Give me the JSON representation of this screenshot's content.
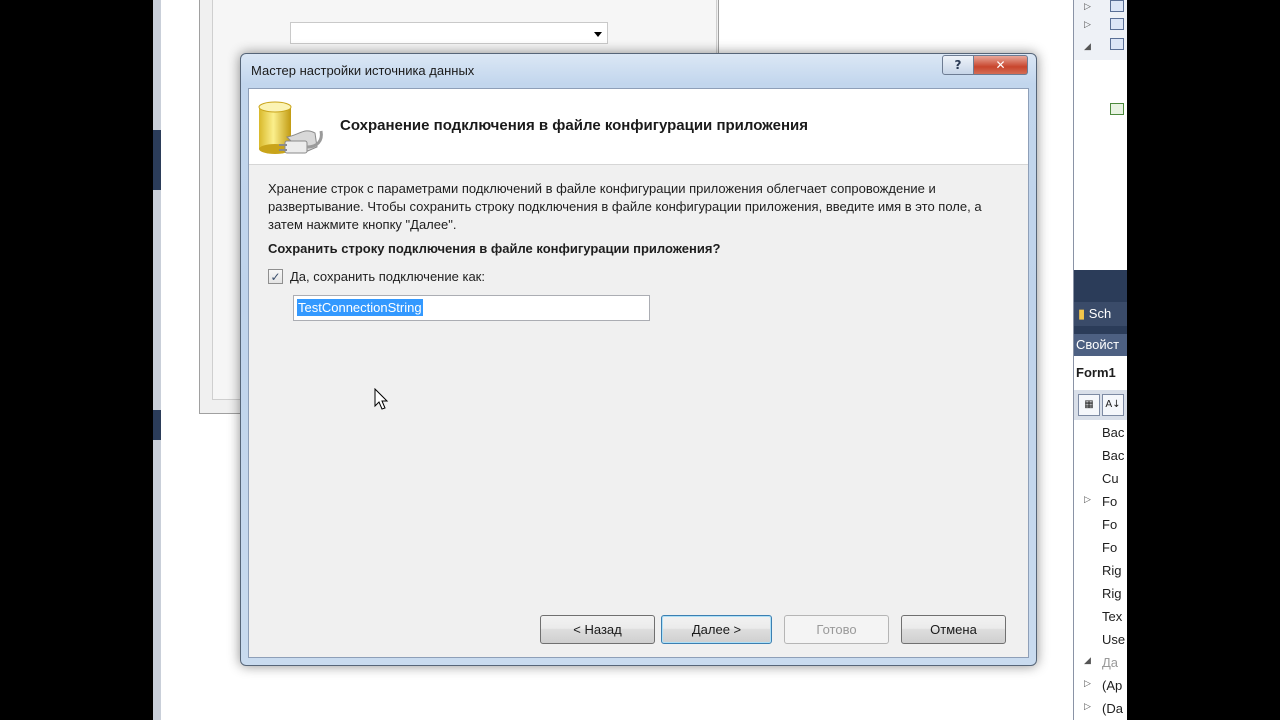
{
  "wizard": {
    "title": "Мастер настройки источника данных",
    "header_title": "Сохранение подключения в файле конфигурации приложения",
    "description": "Хранение строк с параметрами подключений в файле конфигурации приложения облегчает сопровождение и развертывание. Чтобы сохранить строку подключения в файле конфигурации приложения, введите имя в это поле, а затем нажмите кнопку \"Далее\".",
    "question": "Сохранить строку подключения в файле конфигурации приложения?",
    "checkbox_label": "Да, сохранить подключение как:",
    "checkbox_checked": true,
    "connection_name": "TestConnectionString",
    "buttons": {
      "back": "< Назад",
      "next": "Далее >",
      "finish": "Готово",
      "cancel": "Отмена"
    },
    "help_glyph": "?",
    "close_glyph": "✕"
  },
  "right_panel": {
    "tab_label": "Sch",
    "properties_title": "Свойст",
    "object_name": "Form1",
    "properties": [
      "Bac",
      "Bac",
      "Cu",
      "Fo",
      "Fo",
      "Fo",
      "Rig",
      "Rig",
      "Tex",
      "Use",
      "Да",
      "(Ap",
      "(Da"
    ]
  }
}
